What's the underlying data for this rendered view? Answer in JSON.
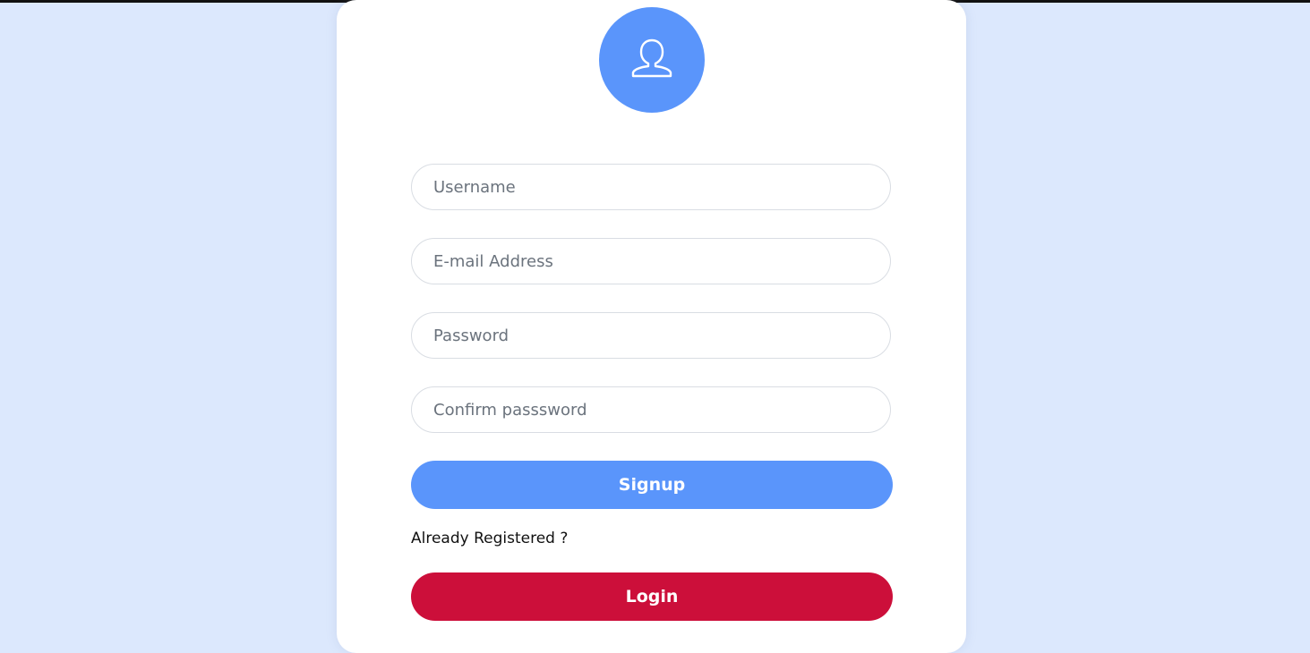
{
  "colors": {
    "background": "#dce8fd",
    "card": "#ffffff",
    "accent_blue": "#5a95fb",
    "login_red": "#cc0f3a"
  },
  "avatar": {
    "icon": "user-icon"
  },
  "form": {
    "username_placeholder": "Username",
    "email_placeholder": "E-mail Address",
    "password_placeholder": "Password",
    "confirm_placeholder": "Confirm passsword",
    "signup_label": "Signup",
    "already_text": "Already Registered ?",
    "login_label": "Login"
  }
}
